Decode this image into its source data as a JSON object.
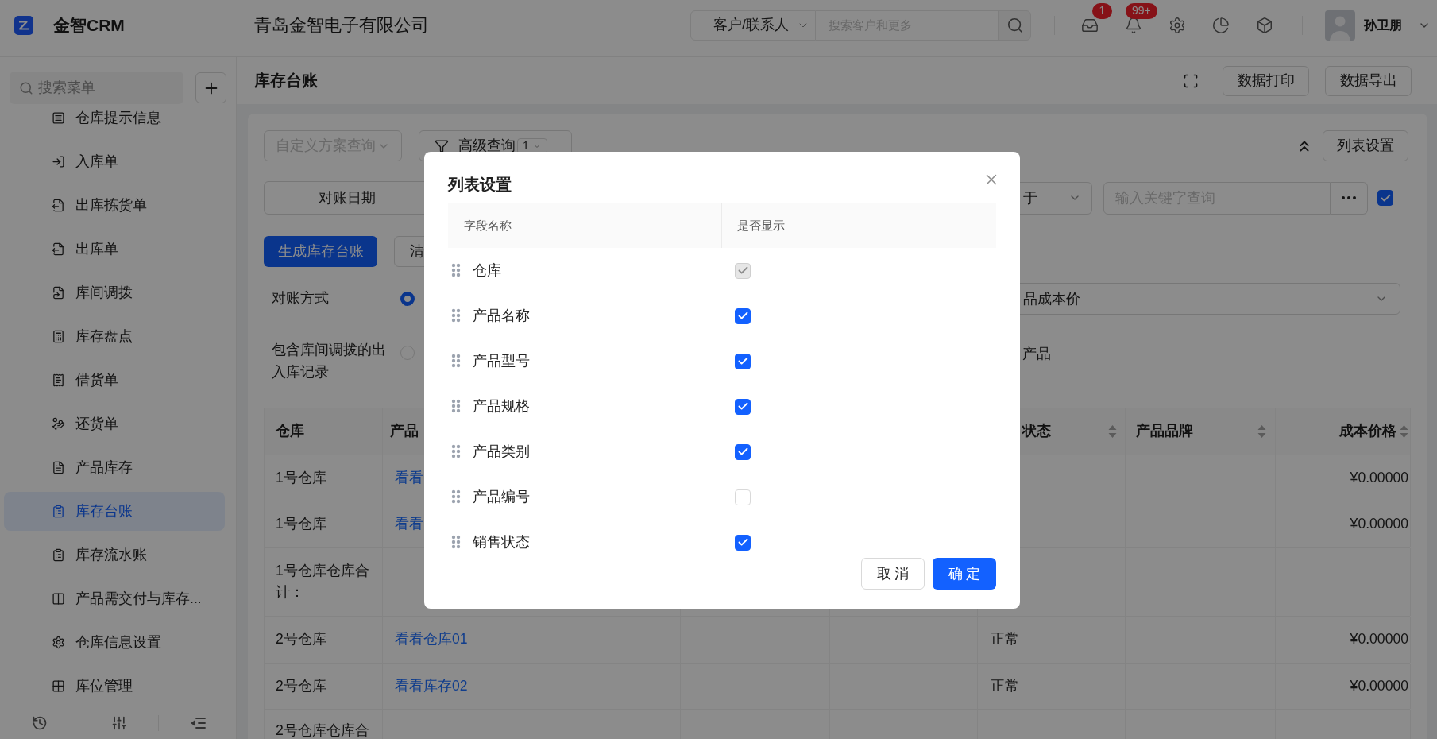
{
  "topbar": {
    "product": "金智CRM",
    "company": "青岛金智电子有限公司",
    "search": {
      "scope": "客户/联系人",
      "placeholder": "搜索客户和更多"
    },
    "badges": [
      {
        "count": "1"
      },
      {
        "count": "99+"
      }
    ],
    "user": {
      "name": "孙卫朋"
    }
  },
  "sidebar": {
    "search": {
      "placeholder": "搜索菜单"
    },
    "items": [
      {
        "label": "仓库提示信息",
        "selected": false
      },
      {
        "label": "入库单",
        "selected": false
      },
      {
        "label": "出库拣货单",
        "selected": false
      },
      {
        "label": "出库单",
        "selected": false
      },
      {
        "label": "库间调拨",
        "selected": false
      },
      {
        "label": "库存盘点",
        "selected": false
      },
      {
        "label": "借货单",
        "selected": false
      },
      {
        "label": "还货单",
        "selected": false
      },
      {
        "label": "产品库存",
        "selected": false
      },
      {
        "label": "库存台账",
        "selected": true
      },
      {
        "label": "库存流水账",
        "selected": false
      },
      {
        "label": "产品需交付与库存...",
        "selected": false
      },
      {
        "label": "仓库信息设置",
        "selected": false
      },
      {
        "label": "库位管理",
        "selected": false
      }
    ]
  },
  "page": {
    "title": "库存台账",
    "buttons": [
      "数据打印",
      "数据导出"
    ]
  },
  "filters": {
    "scheme": {
      "placeholder": "自定义方案查询"
    },
    "advanced": {
      "label": "高级查询",
      "count": "1"
    },
    "list_settings": "列表设置",
    "date_label": "对账日期",
    "operator": {
      "value": "于"
    },
    "keyword": {
      "placeholder": "输入关键字查询"
    },
    "keyword_option": {
      "checked": true
    }
  },
  "actions": {
    "generate": "生成库存台账",
    "clear": "清"
  },
  "options": [
    {
      "label": "对账方式",
      "kind": "select",
      "selected": true,
      "value": "品成本价"
    },
    {
      "label": "包含库间调拨的出入库记录",
      "kind": "text",
      "selected": false,
      "value": "产品"
    }
  ],
  "table": {
    "columns": [
      {
        "label": "仓库",
        "sortable": false
      },
      {
        "label": "产品",
        "sortable": false
      },
      {
        "label": "状态",
        "sortable": true
      },
      {
        "label": "产品品牌",
        "sortable": true
      },
      {
        "label": "成本价格",
        "sortable": true
      }
    ],
    "rows": [
      {
        "warehouse": "1号仓库",
        "product": "看看",
        "cost": "¥0.00000"
      },
      {
        "warehouse": "1号仓库",
        "product": "看看",
        "cost": "¥0.00000"
      },
      {
        "warehouse": "1号仓库仓库合计："
      },
      {
        "warehouse": "2号仓库",
        "product": "看看仓库01",
        "status": "正常",
        "cost": "¥0.00000"
      },
      {
        "warehouse": "2号仓库",
        "product": "看看库存02",
        "status": "正常",
        "cost": "¥0.00000"
      },
      {
        "warehouse": "2号仓库仓库合"
      }
    ]
  },
  "dialog": {
    "title": "列表设置",
    "columns": [
      "字段名称",
      "是否显示"
    ],
    "fields": [
      {
        "name": "仓库",
        "checked": true,
        "disabled": true
      },
      {
        "name": "产品名称",
        "checked": true,
        "disabled": false
      },
      {
        "name": "产品型号",
        "checked": true,
        "disabled": false
      },
      {
        "name": "产品规格",
        "checked": true,
        "disabled": false
      },
      {
        "name": "产品类别",
        "checked": true,
        "disabled": false
      },
      {
        "name": "产品编号",
        "checked": false,
        "disabled": false
      },
      {
        "name": "销售状态",
        "checked": true,
        "disabled": false
      }
    ],
    "buttons": [
      {
        "label": "取 消",
        "kind": "default"
      },
      {
        "label": "确 定",
        "kind": "primary"
      }
    ]
  }
}
